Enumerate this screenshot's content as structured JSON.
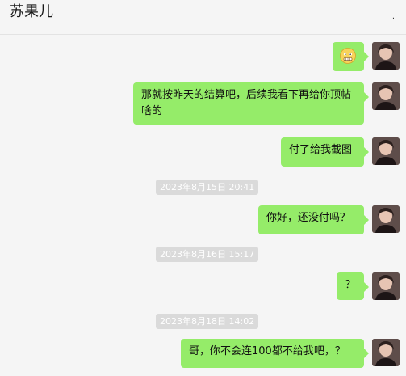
{
  "chat": {
    "title": "苏果儿",
    "more_glyph": "."
  },
  "messages": [
    {
      "kind": "emoji",
      "icon": "grimace-face-emoji"
    },
    {
      "text": "那就按昨天的结算吧，后续我看下再给你顶帖啥的"
    },
    {
      "text": "付了给我截图"
    },
    {
      "time": "2023年8月15日 20:41"
    },
    {
      "text": "你好，还没付吗？"
    },
    {
      "time": "2023年8月16日 15:17"
    },
    {
      "text": "？"
    },
    {
      "time": "2023年8月18日 14:02"
    },
    {
      "text": "哥，你不会连100都不给我吧，？"
    }
  ],
  "colors": {
    "bubble": "#95ec69",
    "background": "#f5f5f5",
    "time_pill": "#dadada"
  }
}
